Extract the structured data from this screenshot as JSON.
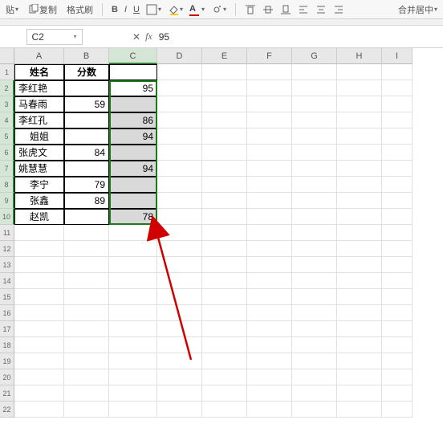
{
  "toolbar": {
    "paste_label": "贴",
    "copy_label": "复制",
    "format_painter_label": "格式刷",
    "merge_label": "合并居中"
  },
  "namebox": {
    "value": "C2"
  },
  "formula_bar": {
    "value": "95"
  },
  "columns": [
    "A",
    "B",
    "C",
    "D",
    "E",
    "F",
    "G",
    "H",
    "I"
  ],
  "header": {
    "name": "姓名",
    "score": "分数"
  },
  "rows": [
    {
      "name": "李红艳",
      "b": "",
      "c": "95"
    },
    {
      "name": "马春雨",
      "b": "59",
      "c": ""
    },
    {
      "name": "李红孔",
      "b": "",
      "c": "86"
    },
    {
      "name": "姐姐",
      "b": "",
      "c": "94"
    },
    {
      "name": "张虎文",
      "b": "84",
      "c": ""
    },
    {
      "name": "姚慧慧",
      "b": "",
      "c": "94"
    },
    {
      "name": "李宁",
      "b": "79",
      "c": ""
    },
    {
      "name": "张鑫",
      "b": "89",
      "c": ""
    },
    {
      "name": "赵凯",
      "b": "",
      "c": "78"
    }
  ],
  "chart_data": {
    "type": "table",
    "title": "",
    "columns": [
      "姓名",
      "分数",
      "C"
    ],
    "data": [
      [
        "李红艳",
        null,
        95
      ],
      [
        "马春雨",
        59,
        null
      ],
      [
        "李红孔",
        null,
        86
      ],
      [
        "姐姐",
        null,
        94
      ],
      [
        "张虎文",
        84,
        null
      ],
      [
        "姚慧慧",
        null,
        94
      ],
      [
        "李宁",
        79,
        null
      ],
      [
        "张鑫",
        89,
        null
      ],
      [
        "赵凯",
        null,
        78
      ]
    ]
  }
}
